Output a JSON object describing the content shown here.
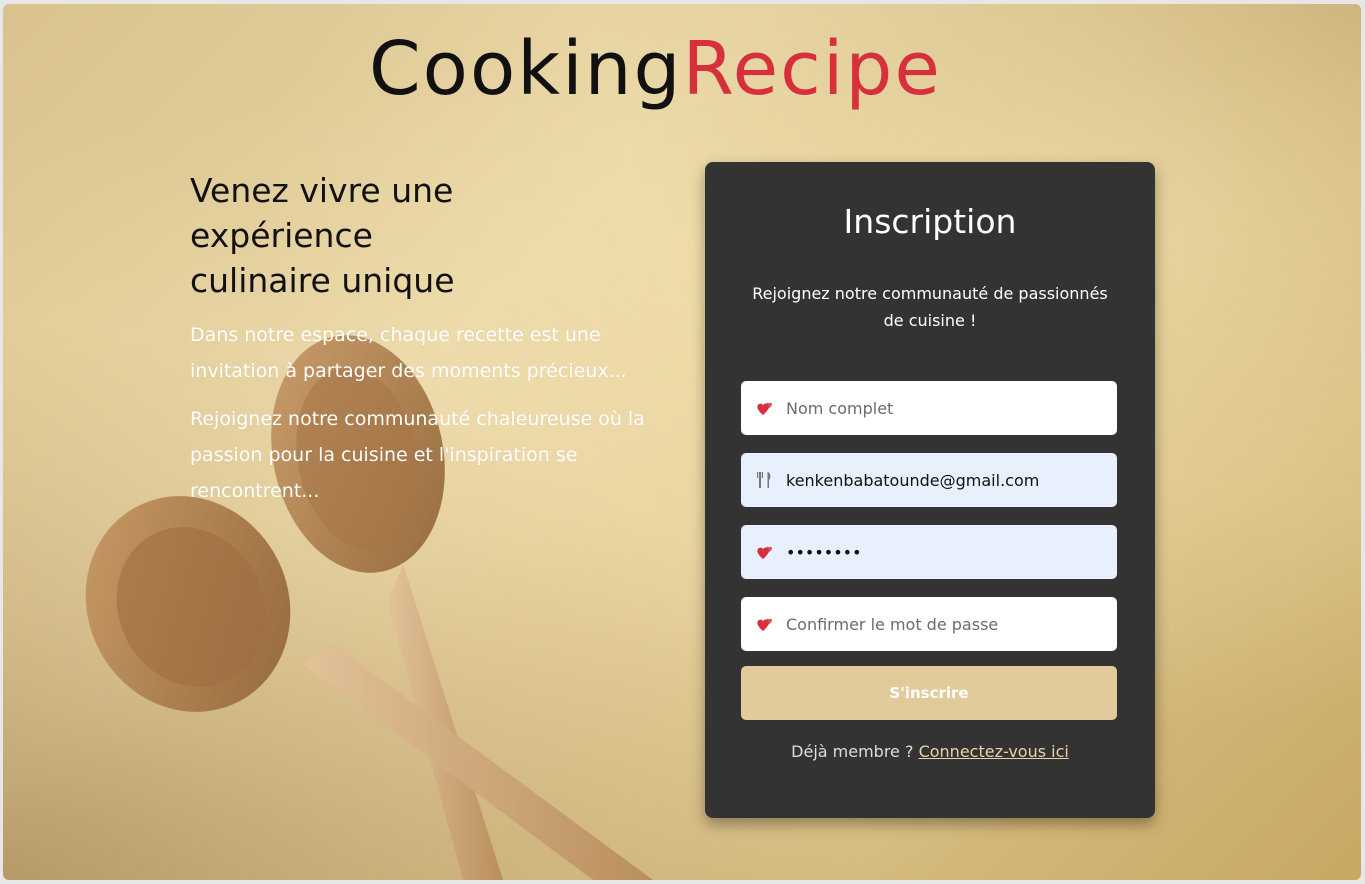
{
  "brand": {
    "part1": "Cooking",
    "part2": "Recipe",
    "color1": "#111111",
    "color2": "#d5303b"
  },
  "intro": {
    "title": "Venez vivre une expérience culinaire unique",
    "p1": "Dans notre espace, chaque recette est une invitation à partager des moments précieux...",
    "p2": "Rejoignez notre communauté chaleureuse où la passion pour la cuisine et l'inspiration se rencontrent..."
  },
  "form": {
    "title": "Inscription",
    "subtitle": "Rejoignez notre communauté de passionnés de cuisine !",
    "fields": [
      {
        "placeholder": "Nom complet",
        "value": "",
        "icon": "hearts-icon"
      },
      {
        "placeholder": "",
        "value": "kenkenbabatounde@gmail.com",
        "icon": "utensils-icon"
      },
      {
        "placeholder": "",
        "value": "••••••••",
        "icon": "hearts-icon"
      },
      {
        "placeholder": "Confirmer le mot de passe",
        "value": "",
        "icon": "hearts-icon"
      }
    ],
    "submit_label": "S'inscrire",
    "login_prompt": "Déjà membre ?",
    "login_link": "Connectez-vous ici",
    "button_color": "#e2cb9b",
    "card_color": "#333333"
  }
}
